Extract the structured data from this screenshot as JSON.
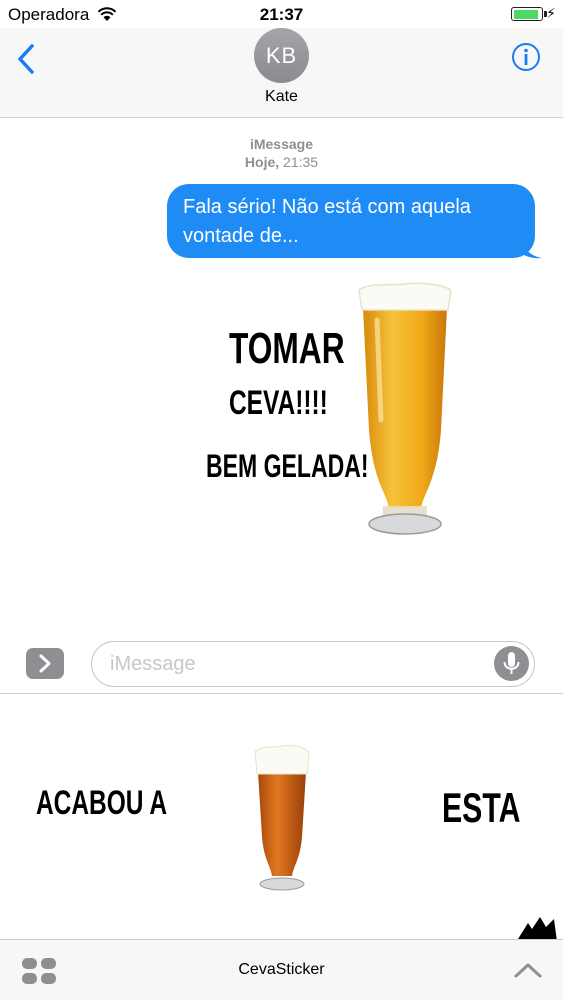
{
  "status_bar": {
    "carrier": "Operadora",
    "time": "21:37",
    "battery_level": 0.95,
    "charging_symbol": "⚡"
  },
  "header": {
    "avatar_initials": "KB",
    "contact_name": "Kate",
    "back_icon": "chevron-left-icon",
    "info_icon": "info-circle-icon"
  },
  "conversation": {
    "service": "iMessage",
    "timestamp_day": "Hoje,",
    "timestamp_time": "21:35",
    "messages": [
      {
        "sender": "me",
        "text": "Fala sério! Não está com aquela vontade de..."
      }
    ],
    "sticker": {
      "lines": [
        "Tomar",
        "Ceva!!!!",
        "Bem Gelada!"
      ]
    }
  },
  "composer": {
    "placeholder": "iMessage",
    "expand_icon": "chevron-right-icon",
    "mic_icon": "microphone-icon"
  },
  "sticker_drawer": {
    "stickers": [
      {
        "text": "Acabou a"
      },
      {
        "image": "beer-glass"
      },
      {
        "text": "Esta"
      }
    ]
  },
  "bottom_bar": {
    "app_name": "CevaSticker",
    "app_drawer_icon": "app-grid-icon",
    "expand_icon": "chevron-up-icon"
  },
  "colors": {
    "bubble": "#1f8cf5",
    "accent": "#1a7cf5",
    "battery": "#4cd964",
    "beer": "#f0a818"
  }
}
